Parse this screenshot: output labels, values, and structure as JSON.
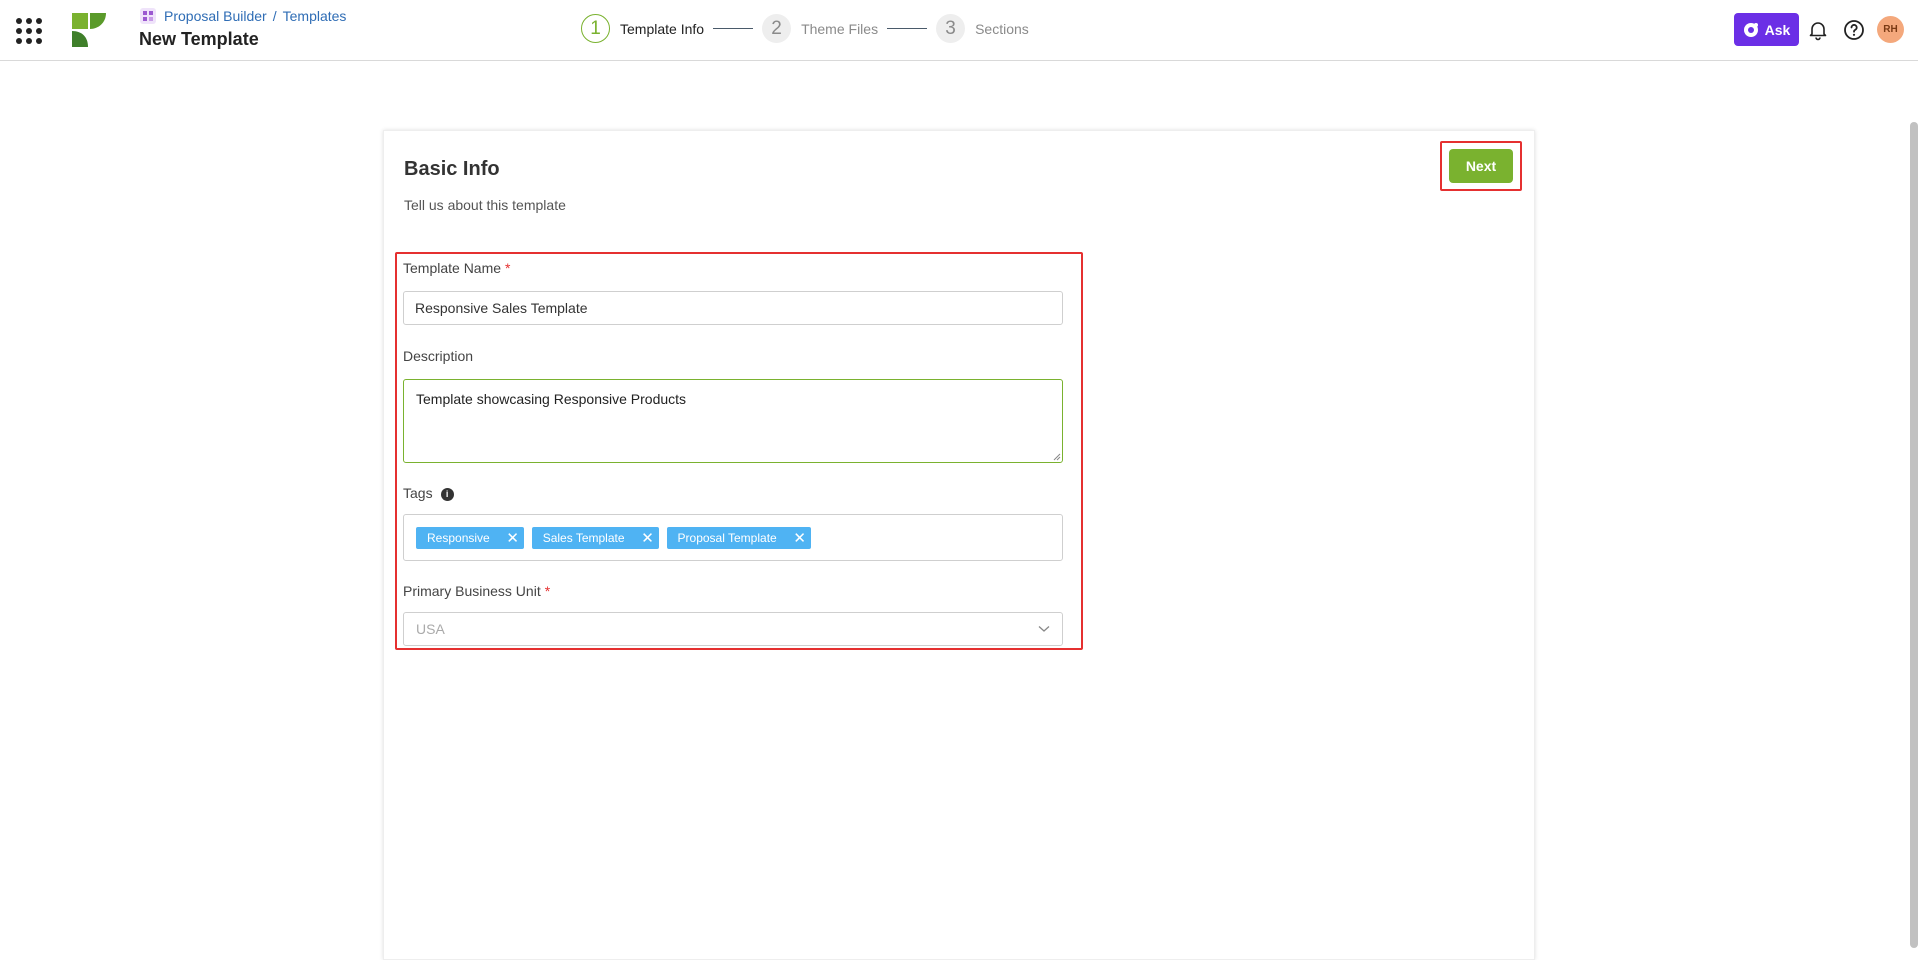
{
  "header": {
    "breadcrumb": {
      "section": "Proposal Builder",
      "separator": "/",
      "current": "Templates"
    },
    "page_title": "New Template",
    "steps": [
      {
        "number": "1",
        "label": "Template Info",
        "active": true
      },
      {
        "number": "2",
        "label": "Theme Files",
        "active": false
      },
      {
        "number": "3",
        "label": "Sections",
        "active": false
      }
    ],
    "ask_label": "Ask",
    "avatar_initials": "RH"
  },
  "card": {
    "title": "Basic Info",
    "subtitle": "Tell us about this template",
    "next_label": "Next"
  },
  "form": {
    "template_name": {
      "label": "Template Name",
      "required_mark": "*",
      "value": "Responsive Sales Template"
    },
    "description": {
      "label": "Description",
      "value": "Template showcasing Responsive Products"
    },
    "tags": {
      "label": "Tags",
      "items": [
        {
          "label": "Responsive",
          "remove": "✕"
        },
        {
          "label": "Sales Template",
          "remove": "✕"
        },
        {
          "label": "Proposal Template",
          "remove": "✕"
        }
      ]
    },
    "business_unit": {
      "label": "Primary Business Unit",
      "required_mark": "*",
      "value": "USA"
    }
  },
  "colors": {
    "accent_green": "#7ab22f",
    "ask_purple": "#6b2fe6",
    "tag_blue": "#4fb3f3",
    "highlight_red": "#e53030",
    "link_blue": "#2f6db5"
  },
  "icons": [
    "apps-grid-icon",
    "logo-icon",
    "breadcrumb-app-icon",
    "ask-sparkle-icon",
    "bell-icon",
    "help-icon",
    "info-icon",
    "close-icon",
    "chevron-down-icon"
  ]
}
